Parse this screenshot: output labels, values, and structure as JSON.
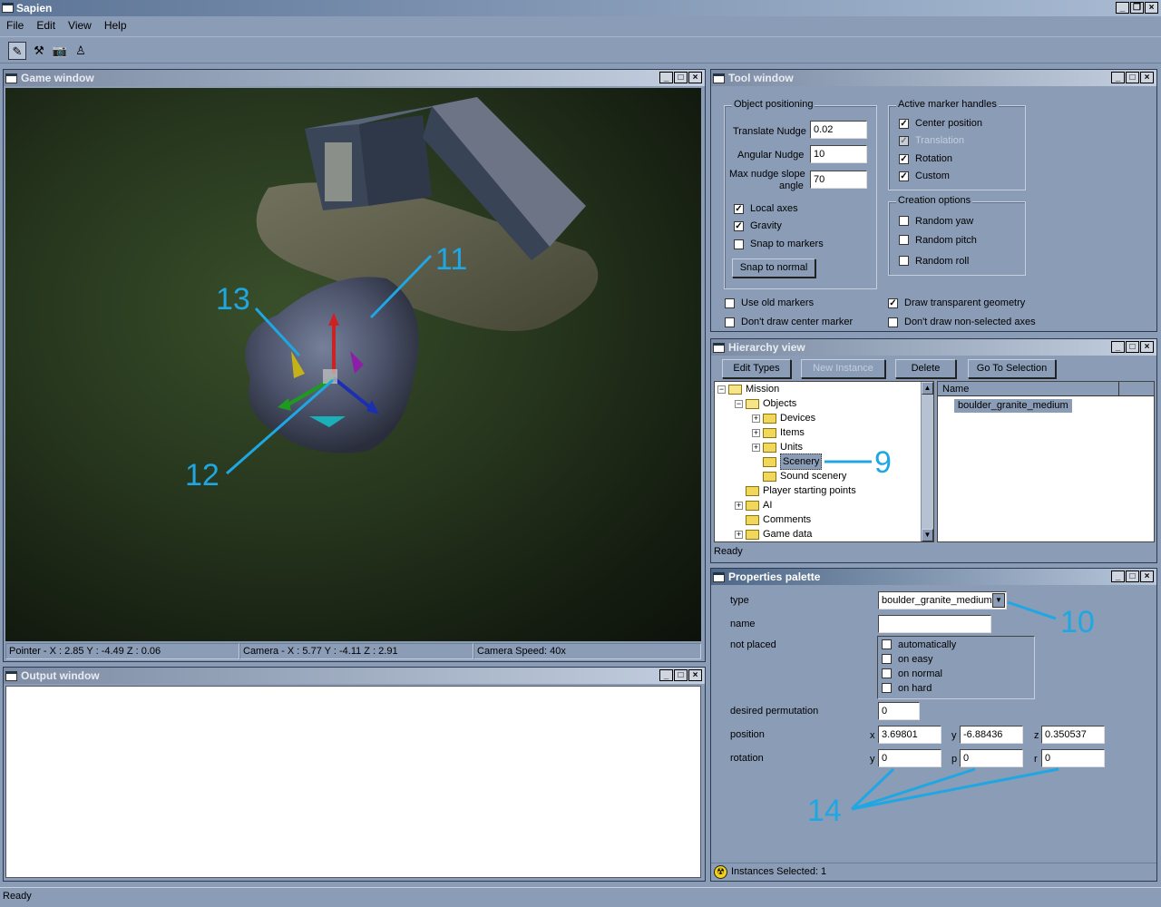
{
  "app": {
    "title": "Sapien"
  },
  "menu": {
    "file": "File",
    "edit": "Edit",
    "view": "View",
    "help": "Help"
  },
  "game_window": {
    "title": "Game window",
    "status": {
      "pointer": "Pointer - X : 2.85  Y : -4.49  Z : 0.06",
      "camera": "Camera - X : 5.77  Y : -4.11  Z : 2.91",
      "speed": "Camera Speed: 40x"
    }
  },
  "output_window": {
    "title": "Output window"
  },
  "tool_window": {
    "title": "Tool window",
    "object_positioning": {
      "label": "Object positioning",
      "translate_nudge_label": "Translate Nudge",
      "translate_nudge": "0.02",
      "angular_nudge_label": "Angular Nudge",
      "angular_nudge": "10",
      "max_nudge_label_1": "Max nudge slope",
      "max_nudge_label_2": "angle",
      "max_nudge": "70",
      "local_axes": "Local axes",
      "gravity": "Gravity",
      "snap_to_markers": "Snap to markers",
      "snap_to_normal": "Snap to normal"
    },
    "active_marker_handles": {
      "label": "Active marker handles",
      "center_position": "Center position",
      "translation": "Translation",
      "rotation": "Rotation",
      "custom": "Custom"
    },
    "creation_options": {
      "label": "Creation options",
      "random_yaw": "Random yaw",
      "random_pitch": "Random pitch",
      "random_roll": "Random roll"
    },
    "use_old_markers": "Use old markers",
    "dont_draw_center": "Don't draw center marker",
    "draw_transparent": "Draw transparent geometry",
    "dont_draw_nonselected": "Don't draw non-selected axes"
  },
  "hierarchy_view": {
    "title": "Hierarchy view",
    "buttons": {
      "edit_types": "Edit Types",
      "new_instance": "New Instance",
      "delete": "Delete",
      "go_to_selection": "Go To Selection"
    },
    "tree": {
      "mission": "Mission",
      "objects": "Objects",
      "devices": "Devices",
      "items": "Items",
      "units": "Units",
      "scenery": "Scenery",
      "sound_scenery": "Sound scenery",
      "player_starting_points": "Player starting points",
      "ai": "AI",
      "comments": "Comments",
      "game_data": "Game data"
    },
    "list_header": "Name",
    "list_items": [
      "boulder_granite_medium"
    ],
    "status": "Ready"
  },
  "properties_palette": {
    "title": "Properties palette",
    "type_label": "type",
    "type_value": "boulder_granite_medium",
    "name_label": "name",
    "name_value": "",
    "not_placed_label": "not placed",
    "not_placed_options": {
      "automatically": "automatically",
      "on_easy": "on easy",
      "on_normal": "on normal",
      "on_hard": "on hard"
    },
    "desired_permutation_label": "desired permutation",
    "desired_permutation": "0",
    "position_label": "position",
    "pos_x_label": "x",
    "pos_x": "3.69801",
    "pos_y_label": "y",
    "pos_y": "-6.88436",
    "pos_z_label": "z",
    "pos_z": "0.350537",
    "rotation_label": "rotation",
    "rot_y_label": "y",
    "rot_y": "0",
    "rot_p_label": "p",
    "rot_p": "0",
    "rot_r_label": "r",
    "rot_r": "0",
    "status": "Instances Selected: 1"
  },
  "annotations": {
    "a9": "9",
    "a10": "10",
    "a11": "11",
    "a12": "12",
    "a13": "13",
    "a14": "14"
  },
  "colors": {
    "annotation": "#1fa7e3",
    "panel": "#8a9cb6",
    "selection": "#8a9cb6"
  },
  "status_bar": "Ready"
}
